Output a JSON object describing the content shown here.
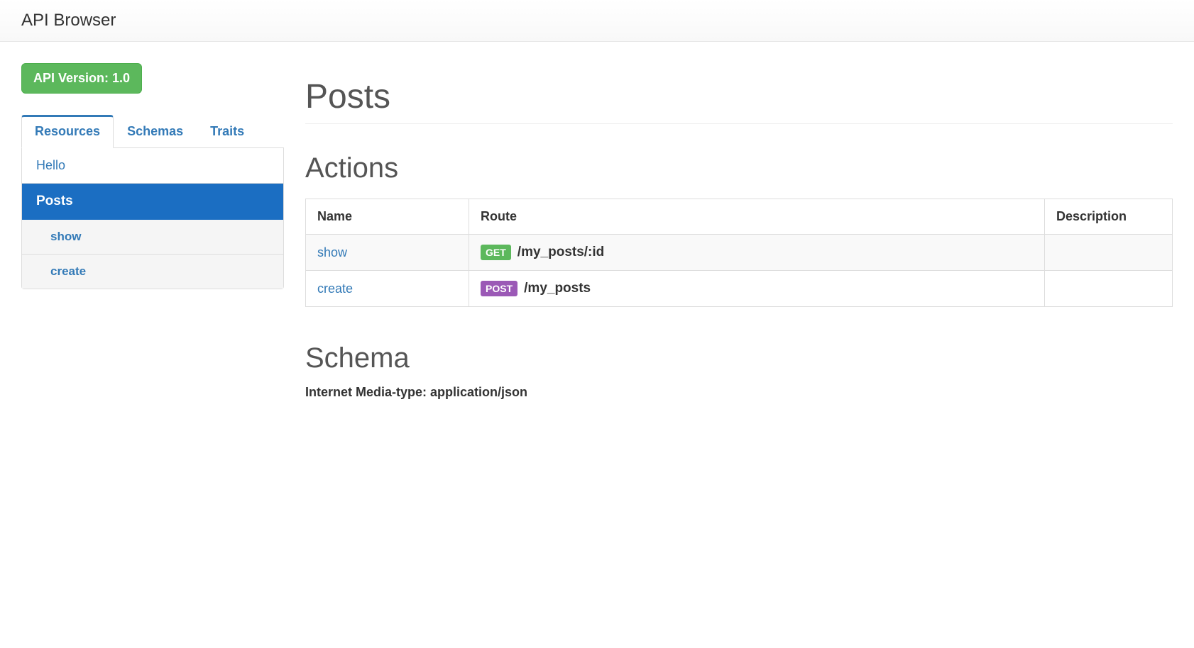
{
  "navbar": {
    "brand": "API Browser"
  },
  "sidebar": {
    "version_label": "API Version: 1.0",
    "tabs": [
      {
        "label": "Resources",
        "active": true
      },
      {
        "label": "Schemas",
        "active": false
      },
      {
        "label": "Traits",
        "active": false
      }
    ],
    "resources": [
      {
        "label": "Hello",
        "active": false,
        "children": []
      },
      {
        "label": "Posts",
        "active": true,
        "children": [
          {
            "label": "show"
          },
          {
            "label": "create"
          }
        ]
      }
    ]
  },
  "main": {
    "title": "Posts",
    "actions_heading": "Actions",
    "actions_table": {
      "headers": {
        "name": "Name",
        "route": "Route",
        "description": "Description"
      },
      "rows": [
        {
          "name": "show",
          "method": "GET",
          "path": "/my_posts/:id",
          "description": ""
        },
        {
          "name": "create",
          "method": "POST",
          "path": "/my_posts",
          "description": ""
        }
      ]
    },
    "schema_heading": "Schema",
    "media_type_label": "Internet Media-type: application/json"
  },
  "colors": {
    "link": "#337ab7",
    "success": "#5cb85c",
    "post": "#9b59b6",
    "active_nav": "#1b6ec2"
  }
}
